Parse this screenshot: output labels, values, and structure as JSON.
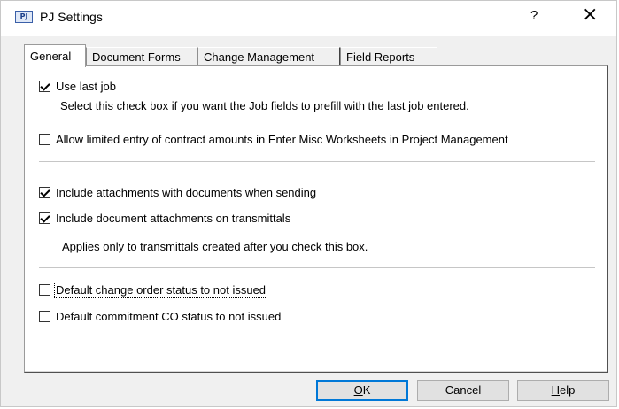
{
  "window": {
    "title": "PJ Settings",
    "icon_label": "PJ",
    "help_glyph": "?",
    "close_glyph": "×"
  },
  "tabs": [
    {
      "label": "General",
      "active": true
    },
    {
      "label": "Document Forms",
      "active": false
    },
    {
      "label": "Change Management",
      "active": false
    },
    {
      "label": "Field Reports",
      "active": false
    }
  ],
  "general": {
    "use_last_job": {
      "label": "Use last job",
      "checked": true,
      "note": "Select this check box if you want the Job fields to prefill with the last job entered."
    },
    "limited_entry": {
      "label": "Allow limited entry of contract amounts in Enter Misc Worksheets in Project Management",
      "checked": false
    },
    "include_attachments": {
      "label": "Include attachments with documents when sending",
      "checked": true
    },
    "transmittal_attachments": {
      "label": "Include document attachments on transmittals",
      "checked": true,
      "note": "Applies only to transmittals created after you check this box."
    },
    "change_order_status": {
      "label": "Default change order status to not issued",
      "checked": false
    },
    "commitment_co_status": {
      "label": "Default commitment CO status to not issued",
      "checked": false
    }
  },
  "buttons": {
    "ok": {
      "accel": "O",
      "rest": "K"
    },
    "cancel": "Cancel",
    "help": {
      "accel": "H",
      "rest": "elp"
    }
  }
}
